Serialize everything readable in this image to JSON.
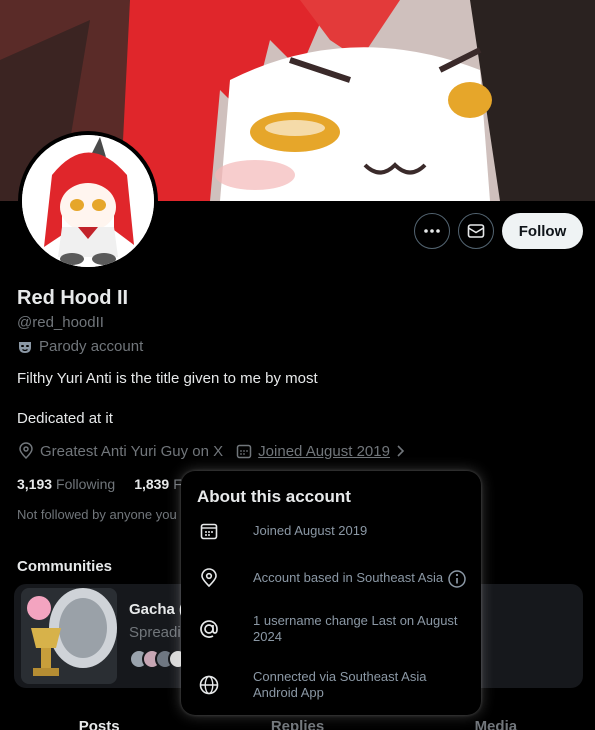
{
  "profile": {
    "name": "Red Hood II",
    "handle": "@red_hoodII",
    "label": "Parody account",
    "bio_line1": "Filthy Yuri Anti is the title given to me by most",
    "bio_line2": "Dedicated at it",
    "location": "Greatest Anti Yuri Guy on X",
    "joined": "Joined August 2019",
    "following_count": "3,193",
    "following_label": "Following",
    "followers_count": "1,839",
    "followers_label": "F",
    "not_followed": "Not followed by anyone you"
  },
  "actions": {
    "more_icon": "more-icon",
    "message_icon": "mail-icon",
    "follow_label": "Follow"
  },
  "communities": {
    "title": "Communities",
    "card_name": "Gacha (",
    "card_desc": "Spreadi"
  },
  "tabs": [
    "Posts",
    "Replies",
    "Media"
  ],
  "about_popup": {
    "title": "About this account",
    "joined": "Joined August 2019",
    "based": "Account based in Southeast Asia",
    "username_change": "1 username change Last on August 2024",
    "connected": "Connected via Southeast Asia Android App"
  },
  "colors": {
    "background": "#000000",
    "text_primary": "#e7e9ea",
    "text_secondary": "#71767b",
    "follow_bg": "#eff3f4",
    "hair_red": "#e0262b"
  }
}
